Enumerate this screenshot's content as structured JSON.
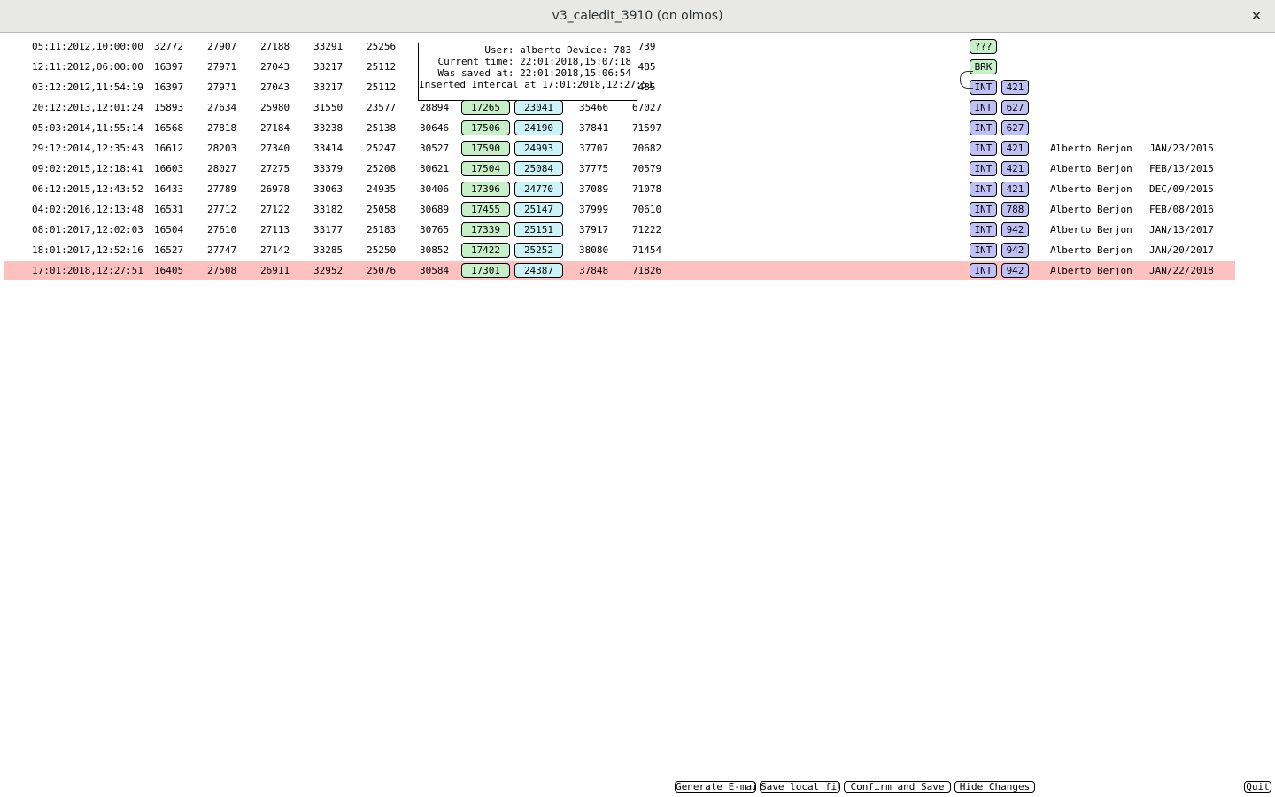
{
  "window": {
    "title": "v3_caledit_3910 (on olmos)",
    "close_glyph": "×"
  },
  "table": {
    "rows": [
      {
        "ts": "05:11:2012,10:00:00",
        "v1": "32772",
        "v2": "27907",
        "v3": "27188",
        "v4": "33291",
        "v5": "25256",
        "v6": "",
        "g": "",
        "c": "",
        "v7": "",
        "v8": "7739",
        "tag": "???",
        "tag_color": "green",
        "num": "",
        "user": "",
        "date": ""
      },
      {
        "ts": "12:11:2012,06:00:00",
        "v1": "16397",
        "v2": "27971",
        "v3": "27043",
        "v4": "33217",
        "v5": "25112",
        "v6": "",
        "g": "",
        "c": "",
        "v7": "",
        "v8": "1485",
        "tag": "BRK",
        "tag_color": "green",
        "num": "",
        "user": "",
        "date": ""
      },
      {
        "ts": "03:12:2012,11:54:19",
        "v1": "16397",
        "v2": "27971",
        "v3": "27043",
        "v4": "33217",
        "v5": "25112",
        "v6": "",
        "g": "",
        "c": "",
        "v7": "",
        "v8": "1485",
        "tag": "INT",
        "tag_color": "purple",
        "num": "421",
        "user": "",
        "date": ""
      },
      {
        "ts": "20:12:2013,12:01:24",
        "v1": "15893",
        "v2": "27634",
        "v3": "25980",
        "v4": "31550",
        "v5": "23577",
        "v6": "28894",
        "g": "17265",
        "c": "23041",
        "v7": "35466",
        "v8": "67027",
        "tag": "INT",
        "tag_color": "purple",
        "num": "627",
        "user": "",
        "date": ""
      },
      {
        "ts": "05:03:2014,11:55:14",
        "v1": "16568",
        "v2": "27818",
        "v3": "27184",
        "v4": "33238",
        "v5": "25138",
        "v6": "30646",
        "g": "17506",
        "c": "24190",
        "v7": "37841",
        "v8": "71597",
        "tag": "INT",
        "tag_color": "purple",
        "num": "627",
        "user": "",
        "date": ""
      },
      {
        "ts": "29:12:2014,12:35:43",
        "v1": "16612",
        "v2": "28203",
        "v3": "27340",
        "v4": "33414",
        "v5": "25247",
        "v6": "30527",
        "g": "17590",
        "c": "24993",
        "v7": "37707",
        "v8": "70682",
        "tag": "INT",
        "tag_color": "purple",
        "num": "421",
        "user": "Alberto Berjon",
        "date": "JAN/23/2015"
      },
      {
        "ts": "09:02:2015,12:18:41",
        "v1": "16603",
        "v2": "28027",
        "v3": "27275",
        "v4": "33379",
        "v5": "25208",
        "v6": "30621",
        "g": "17504",
        "c": "25084",
        "v7": "37775",
        "v8": "70579",
        "tag": "INT",
        "tag_color": "purple",
        "num": "421",
        "user": "Alberto Berjon",
        "date": "FEB/13/2015"
      },
      {
        "ts": "06:12:2015,12:43:52",
        "v1": "16433",
        "v2": "27789",
        "v3": "26978",
        "v4": "33063",
        "v5": "24935",
        "v6": "30406",
        "g": "17396",
        "c": "24770",
        "v7": "37089",
        "v8": "71078",
        "tag": "INT",
        "tag_color": "purple",
        "num": "421",
        "user": "Alberto Berjon",
        "date": "DEC/09/2015"
      },
      {
        "ts": "04:02:2016,12:13:48",
        "v1": "16531",
        "v2": "27712",
        "v3": "27122",
        "v4": "33182",
        "v5": "25058",
        "v6": "30689",
        "g": "17455",
        "c": "25147",
        "v7": "37999",
        "v8": "70610",
        "tag": "INT",
        "tag_color": "purple",
        "num": "788",
        "user": "Alberto Berjon",
        "date": "FEB/08/2016"
      },
      {
        "ts": "08:01:2017,12:02:03",
        "v1": "16504",
        "v2": "27610",
        "v3": "27113",
        "v4": "33177",
        "v5": "25183",
        "v6": "30765",
        "g": "17339",
        "c": "25151",
        "v7": "37917",
        "v8": "71222",
        "tag": "INT",
        "tag_color": "purple",
        "num": "942",
        "user": "Alberto Berjon",
        "date": "JAN/13/2017"
      },
      {
        "ts": "18:01:2017,12:52:16",
        "v1": "16527",
        "v2": "27747",
        "v3": "27142",
        "v4": "33285",
        "v5": "25250",
        "v6": "30852",
        "g": "17422",
        "c": "25252",
        "v7": "38080",
        "v8": "71454",
        "tag": "INT",
        "tag_color": "purple",
        "num": "942",
        "user": "Alberto Berjon",
        "date": "JAN/20/2017"
      },
      {
        "ts": "17:01:2018,12:27:51",
        "v1": "16405",
        "v2": "27508",
        "v3": "26911",
        "v4": "32952",
        "v5": "25076",
        "v6": "30584",
        "g": "17301",
        "c": "24387",
        "v7": "37848",
        "v8": "71826",
        "tag": "INT",
        "tag_color": "purple",
        "num": "942",
        "user": "Alberto Berjon",
        "date": "JAN/22/2018",
        "selected": true
      }
    ]
  },
  "tooltip": {
    "lines": [
      "User: alberto Device: 783",
      "Current time: 22:01:2018,15:07:18",
      "Was saved at: 22:01:2018,15:06:54",
      "Inserted Intercal at 17:01:2018,12:27:51"
    ]
  },
  "buttons": {
    "email": "Generate E-mail",
    "save_local": "Save local file",
    "confirm": "Confirm and Save",
    "hide": "Hide Changes",
    "quit": "Quit"
  },
  "colors": {
    "selected_row": "#ffc0c0",
    "green_box": "#c8f0c8",
    "cyan_box": "#ccf4f8",
    "purple_box": "#c0c0f4"
  }
}
